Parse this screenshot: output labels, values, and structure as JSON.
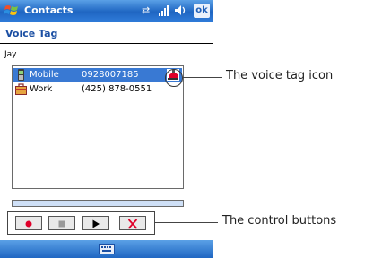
{
  "titlebar": {
    "app_title": "Contacts",
    "ok_label": "ok"
  },
  "header": {
    "page_title": "Voice Tag"
  },
  "contact": {
    "name": "Jay"
  },
  "phones": [
    {
      "label": "Mobile",
      "number": "0928007185",
      "selected": true,
      "has_voice_tag": true
    },
    {
      "label": "Work",
      "number": "(425) 878-0551",
      "selected": false,
      "has_voice_tag": false
    }
  ],
  "progress": {
    "fraction": 0
  },
  "controls": [
    "record",
    "stop",
    "play",
    "delete"
  ],
  "callouts": {
    "voice_tag": "The voice tag icon",
    "controls": "The control buttons"
  },
  "colors": {
    "accent": "#1f66c2",
    "selection": "#3979d3",
    "record": "#e0002a",
    "delete": "#e0002a"
  }
}
